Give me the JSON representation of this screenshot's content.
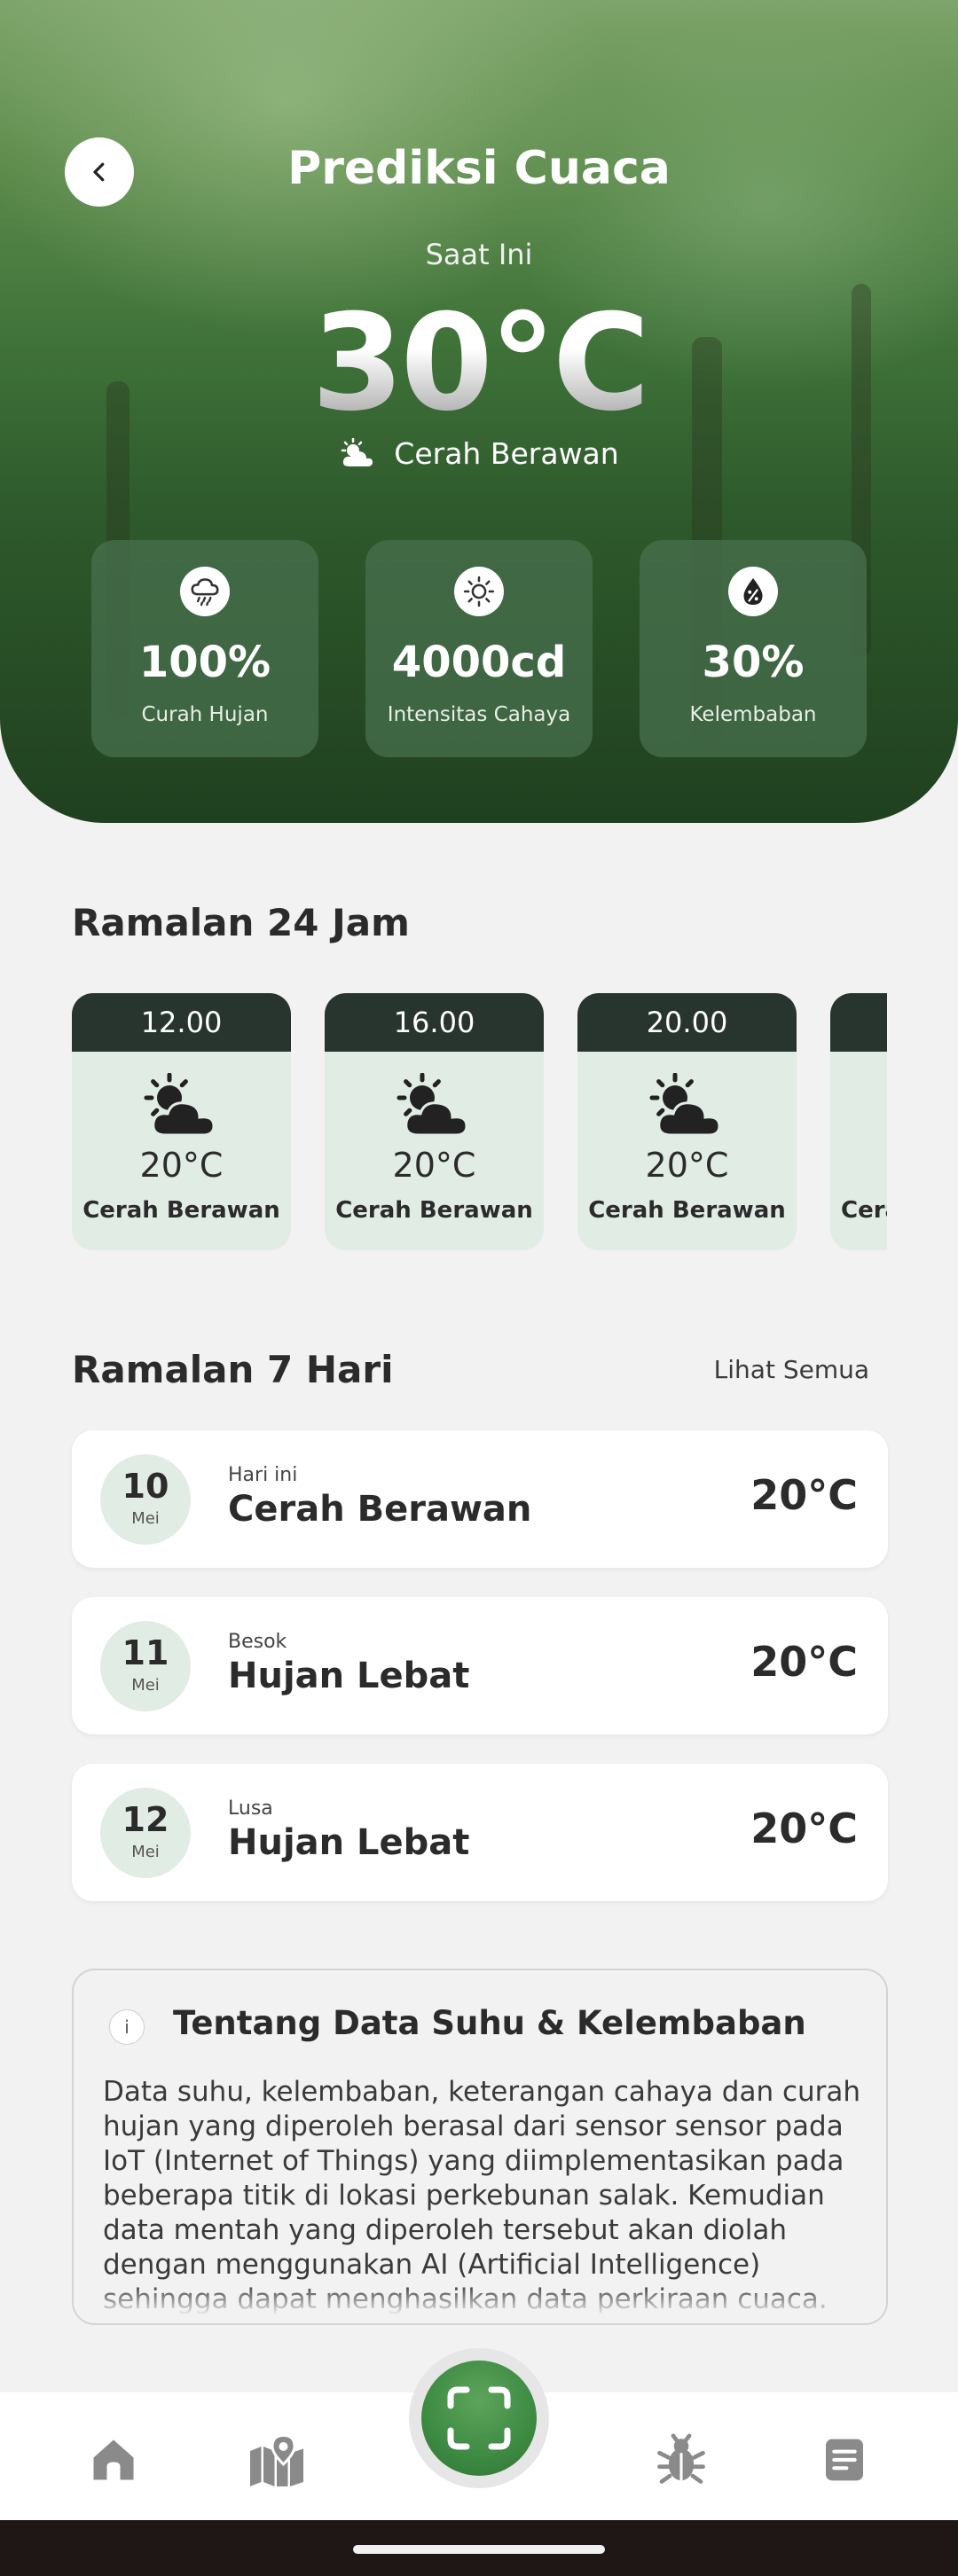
{
  "header": {
    "title": "Prediksi Cuaca",
    "subtitle": "Saat Ini",
    "temperature": "30°C",
    "condition": "Cerah Berawan",
    "condition_icon": "partly-cloudy-icon"
  },
  "stats": [
    {
      "icon": "rain-cloud-icon",
      "value": "100%",
      "label": "Curah Hujan"
    },
    {
      "icon": "sun-icon",
      "value": "4000cd",
      "label": "Intensitas Cahaya"
    },
    {
      "icon": "humidity-drop-icon",
      "value": "30%",
      "label": "Kelembaban"
    }
  ],
  "hourly": {
    "title": "Ramalan 24 Jam",
    "items": [
      {
        "time": "12.00",
        "temp": "20°C",
        "condition": "Cerah Berawan",
        "icon": "partly-cloudy-icon"
      },
      {
        "time": "16.00",
        "temp": "20°C",
        "condition": "Cerah Berawan",
        "icon": "partly-cloudy-icon"
      },
      {
        "time": "20.00",
        "temp": "20°C",
        "condition": "Cerah Berawan",
        "icon": "partly-cloudy-icon"
      },
      {
        "time": "",
        "temp": "",
        "condition": "Cerah Berawan",
        "icon": "partly-cloudy-icon"
      }
    ]
  },
  "daily": {
    "title": "Ramalan 7 Hari",
    "see_all": "Lihat Semua",
    "items": [
      {
        "day": "10",
        "month": "Mei",
        "relative": "Hari ini",
        "condition": "Cerah Berawan",
        "temp": "20°C"
      },
      {
        "day": "11",
        "month": "Mei",
        "relative": "Besok",
        "condition": "Hujan Lebat",
        "temp": "20°C"
      },
      {
        "day": "12",
        "month": "Mei",
        "relative": "Lusa",
        "condition": "Hujan Lebat",
        "temp": "20°C"
      }
    ]
  },
  "info": {
    "icon_label": "i",
    "title": "Tentang Data Suhu & Kelembaban",
    "body": "Data suhu, kelembaban, keterangan cahaya dan curah hujan yang diperoleh berasal dari sensor sensor pada IoT (Internet of Things) yang diimplementasikan pada beberapa titik di lokasi perkebunan salak. Kemudian data mentah yang diperoleh tersebut akan diolah dengan menggunakan AI (Artificial Intelligence) sehingga dapat menghasilkan data perkiraan cuaca."
  },
  "nav": {
    "items": [
      "home-icon",
      "map-icon",
      "scan-icon",
      "bug-icon",
      "document-icon"
    ],
    "active_color": "#3d8a42"
  },
  "colors": {
    "accent_green": "#3d8a42",
    "hour_header": "#28352e",
    "light_green": "#e1ece4",
    "icon_gray": "#8a8a8a"
  }
}
